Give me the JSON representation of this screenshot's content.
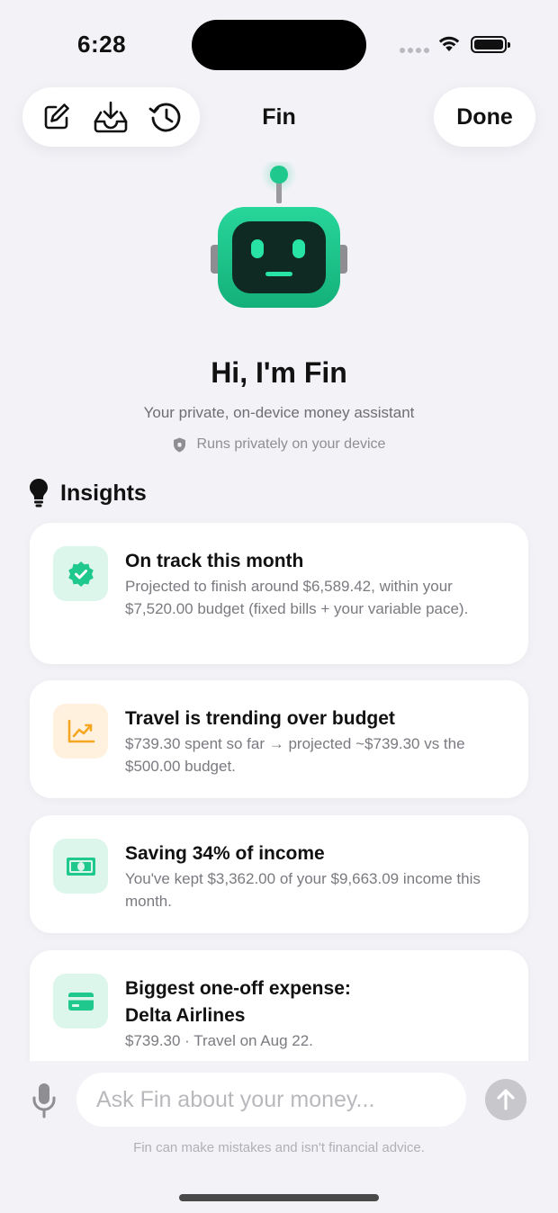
{
  "status": {
    "time": "6:28"
  },
  "nav": {
    "title": "Fin",
    "done_label": "Done"
  },
  "hero": {
    "greeting": "Hi, I'm Fin",
    "subtitle": "Your private, on-device money assistant",
    "privacy_note": "Runs privately on your device"
  },
  "insights": {
    "header": "Insights",
    "cards": [
      {
        "title": "On track this month",
        "body": "Projected to finish around $6,589.42, within your $7,520.00 budget (fixed bills + your variable pace).",
        "icon": "verified-badge-icon"
      },
      {
        "title": "Travel is trending over budget",
        "body": "$739.30 spent so far → projected ~$739.30 vs the $500.00 budget.",
        "icon": "trending-up-icon"
      },
      {
        "title": "Saving 34% of income",
        "body": "You've kept $3,362.00 of your $9,663.09 income this month.",
        "icon": "banknote-icon"
      },
      {
        "title": "Biggest one-off expense: Delta Airlines",
        "body": "$739.30 · Travel on Aug 22.",
        "icon": "credit-card-icon"
      }
    ]
  },
  "composer": {
    "placeholder": "Ask Fin about your money...",
    "value": "",
    "disclaimer": "Fin can make mistakes and isn't financial advice."
  },
  "colors": {
    "accent": "#1fc98e",
    "warning": "#f5a623",
    "background": "#f2f2f7"
  }
}
